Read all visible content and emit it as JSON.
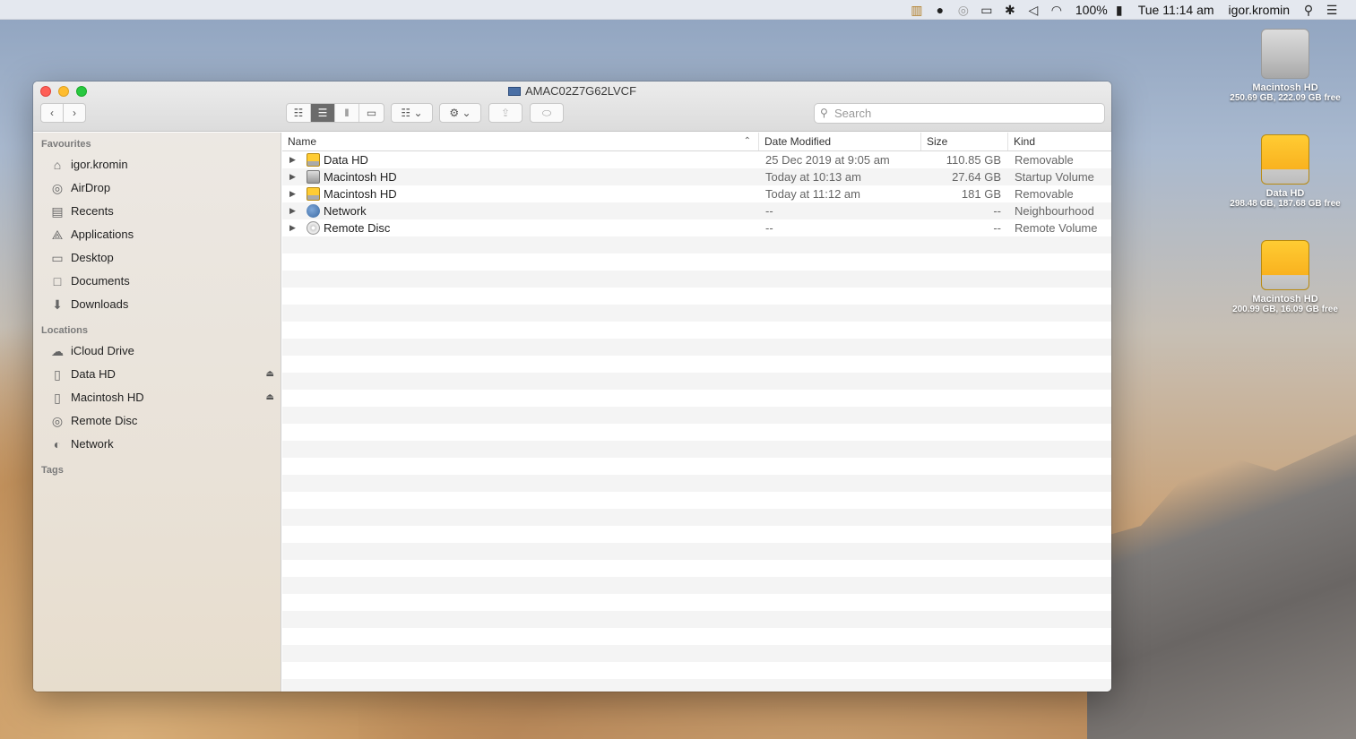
{
  "menubar": {
    "battery": "100%",
    "clock": "Tue 11:14 am",
    "user": "igor.kromin"
  },
  "desktop": {
    "items": [
      {
        "name": "Macintosh HD",
        "sub": "250.69 GB, 222.09 GB free"
      },
      {
        "name": "Data HD",
        "sub": "298.48 GB, 187.68 GB free"
      },
      {
        "name": "Macintosh HD",
        "sub": "200.99 GB, 16.09 GB free"
      }
    ]
  },
  "window": {
    "title": "AMAC02Z7G62LVCF",
    "search_placeholder": "Search"
  },
  "sidebar": {
    "favourites_heading": "Favourites",
    "favourites": [
      {
        "label": "igor.kromin",
        "icon": "home-icon"
      },
      {
        "label": "AirDrop",
        "icon": "airdrop-icon"
      },
      {
        "label": "Recents",
        "icon": "recents-icon"
      },
      {
        "label": "Applications",
        "icon": "applications-icon"
      },
      {
        "label": "Desktop",
        "icon": "desktop-icon"
      },
      {
        "label": "Documents",
        "icon": "documents-icon"
      },
      {
        "label": "Downloads",
        "icon": "downloads-icon"
      }
    ],
    "locations_heading": "Locations",
    "locations": [
      {
        "label": "iCloud Drive",
        "icon": "cloud-icon"
      },
      {
        "label": "Data HD",
        "icon": "disk-icon"
      },
      {
        "label": "Macintosh HD",
        "icon": "disk-icon"
      },
      {
        "label": "Remote Disc",
        "icon": "disc-icon"
      },
      {
        "label": "Network",
        "icon": "network-icon"
      }
    ],
    "tags_heading": "Tags"
  },
  "list": {
    "columns": {
      "name": "Name",
      "date": "Date Modified",
      "size": "Size",
      "kind": "Kind"
    },
    "rows": [
      {
        "name": "Data HD",
        "date": "25 Dec 2019 at 9:05 am",
        "size": "110.85 GB",
        "kind": "Removable"
      },
      {
        "name": "Macintosh HD",
        "date": "Today at 10:13 am",
        "size": "27.64 GB",
        "kind": "Startup Volume"
      },
      {
        "name": "Macintosh HD",
        "date": "Today at 11:12 am",
        "size": "181 GB",
        "kind": "Removable"
      },
      {
        "name": "Network",
        "date": "--",
        "size": "--",
        "kind": "Neighbourhood"
      },
      {
        "name": "Remote Disc",
        "date": "--",
        "size": "--",
        "kind": "Remote Volume"
      }
    ]
  }
}
